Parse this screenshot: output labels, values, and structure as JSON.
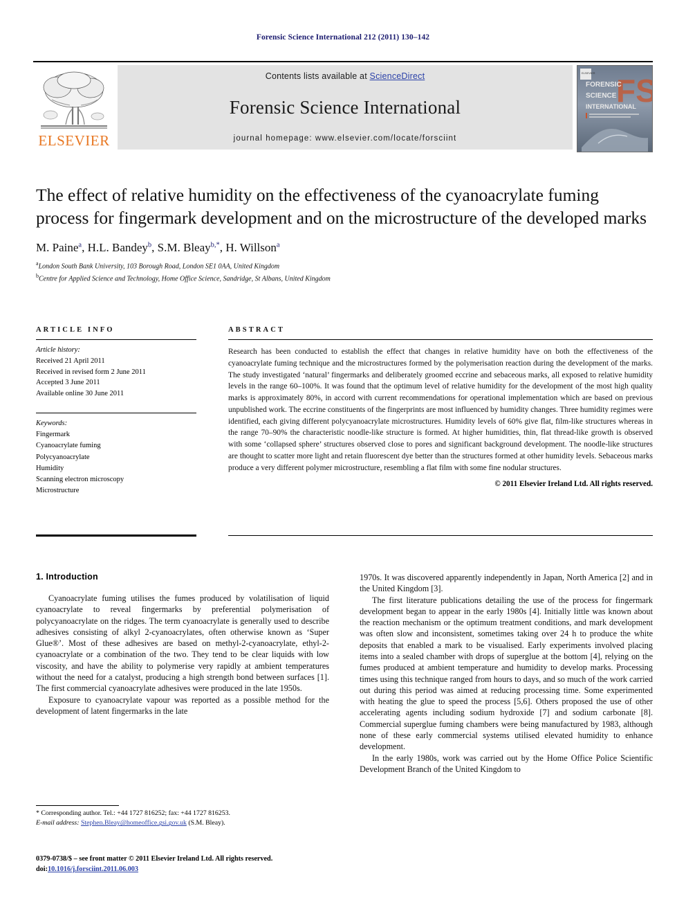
{
  "running_head": "Forensic Science International 212 (2011) 130–142",
  "masthead": {
    "publisher": "ELSEVIER",
    "contents_prefix": "Contents lists available at ",
    "contents_link": "ScienceDirect",
    "journal_title": "Forensic Science International",
    "homepage": "journal homepage: www.elsevier.com/locate/forsciint",
    "cover_lines": [
      "FORENSIC",
      "SCIENCE",
      "INTERNATIONAL"
    ],
    "cover_mark": "FSI"
  },
  "colors": {
    "elsevier_orange": "#e87722",
    "link_blue": "#2b41a8",
    "running_head_blue": "#1a1a6e",
    "band_grey": "#e3e3e3"
  },
  "article": {
    "title": "The effect of relative humidity on the effectiveness of the cyanoacrylate fuming process for fingermark development and on the microstructure of the developed marks",
    "authors_html": "M. Paine <sup>a</sup>, H.L. Bandey <sup>b</sup>, S.M. Bleay <sup>b,*</sup>, H. Willson <sup>a</sup>",
    "affiliations": [
      {
        "marker": "a",
        "text": "London South Bank University, 103 Borough Road, London SE1 0AA, United Kingdom"
      },
      {
        "marker": "b",
        "text": "Centre for Applied Science and Technology, Home Office Science, Sandridge, St Albans, United Kingdom"
      }
    ]
  },
  "article_info": {
    "heading": "ARTICLE INFO",
    "history_label": "Article history:",
    "history": [
      "Received 21 April 2011",
      "Received in revised form 2 June 2011",
      "Accepted 3 June 2011",
      "Available online 30 June 2011"
    ],
    "keywords_label": "Keywords:",
    "keywords": [
      "Fingermark",
      "Cyanoacrylate fuming",
      "Polycyanoacrylate",
      "Humidity",
      "Scanning electron microscopy",
      "Microstructure"
    ]
  },
  "abstract": {
    "heading": "ABSTRACT",
    "text": "Research has been conducted to establish the effect that changes in relative humidity have on both the effectiveness of the cyanoacrylate fuming technique and the microstructures formed by the polymerisation reaction during the development of the marks. The study investigated ‘natural’ fingermarks and deliberately groomed eccrine and sebaceous marks, all exposed to relative humidity levels in the range 60–100%. It was found that the optimum level of relative humidity for the development of the most high quality marks is approximately 80%, in accord with current recommendations for operational implementation which are based on previous unpublished work. The eccrine constituents of the fingerprints are most influenced by humidity changes. Three humidity regimes were identified, each giving different polycyanoacrylate microstructures. Humidity levels of 60% give flat, film-like structures whereas in the range 70–90% the characteristic noodle-like structure is formed. At higher humidities, thin, flat thread-like growth is observed with some ‘collapsed sphere’ structures observed close to pores and significant background development. The noodle-like structures are thought to scatter more light and retain fluorescent dye better than the structures formed at other humidity levels. Sebaceous marks produce a very different polymer microstructure, resembling a flat film with some fine nodular structures.",
    "copyright": "© 2011 Elsevier Ireland Ltd. All rights reserved."
  },
  "introduction": {
    "heading": "1. Introduction",
    "left_paragraphs": [
      "Cyanoacrylate fuming utilises the fumes produced by volatilisation of liquid cyanoacrylate to reveal fingermarks by preferential polymerisation of polycyanoacrylate on the ridges. The term cyanoacrylate is generally used to describe adhesives consisting of alkyl 2-cyanoacrylates, often otherwise known as ‘Super Glue®’. Most of these adhesives are based on methyl-2-cyanoacrylate, ethyl-2-cyanoacrylate or a combination of the two. They tend to be clear liquids with low viscosity, and have the ability to polymerise very rapidly at ambient temperatures without the need for a catalyst, producing a high strength bond between surfaces [1]. The first commercial cyanoacrylate adhesives were produced in the late 1950s.",
      "Exposure to cyanoacrylate vapour was reported as a possible method for the development of latent fingermarks in the late"
    ],
    "right_paragraphs": [
      "1970s. It was discovered apparently independently in Japan, North America [2] and in the United Kingdom [3].",
      "The first literature publications detailing the use of the process for fingermark development began to appear in the early 1980s [4]. Initially little was known about the reaction mechanism or the optimum treatment conditions, and mark development was often slow and inconsistent, sometimes taking over 24 h to produce the white deposits that enabled a mark to be visualised. Early experiments involved placing items into a sealed chamber with drops of superglue at the bottom [4], relying on the fumes produced at ambient temperature and humidity to develop marks. Processing times using this technique ranged from hours to days, and so much of the work carried out during this period was aimed at reducing processing time. Some experimented with heating the glue to speed the process [5,6]. Others proposed the use of other accelerating agents including sodium hydroxide [7] and sodium carbonate [8]. Commercial superglue fuming chambers were being manufactured by 1983, although none of these early commercial systems utilised elevated humidity to enhance development.",
      "In the early 1980s, work was carried out by the Home Office Police Scientific Development Branch of the United Kingdom to"
    ]
  },
  "footnote": {
    "corresponding": "* Corresponding author. Tel.: +44 1727 816252; fax: +44 1727 816253.",
    "email_label": "E-mail address:",
    "email": "Stephen.Bleay@homeoffice.gsi.gov.uk",
    "email_suffix": "(S.M. Bleay)."
  },
  "imprint": {
    "line1": "0379-0738/$ – see front matter © 2011 Elsevier Ireland Ltd. All rights reserved.",
    "doi_label": "doi:",
    "doi_value": "10.1016/j.forsciint.2011.06.003"
  }
}
